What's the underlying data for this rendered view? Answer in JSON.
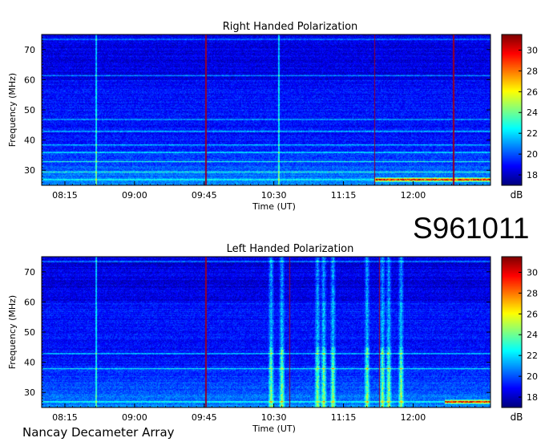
{
  "observation_id": "S961011",
  "instrument": "Nancay Decameter Array",
  "chart_data": [
    {
      "type": "heatmap",
      "title": "Right Handed Polarization",
      "xlabel": "Time (UT)",
      "ylabel": "Frequency (MHz)",
      "x_ticks": [
        "08:15",
        "09:00",
        "09:45",
        "10:30",
        "11:15",
        "12:00"
      ],
      "y_ticks": [
        30,
        40,
        50,
        60,
        70
      ],
      "xlim": [
        "08:00",
        "12:50"
      ],
      "ylim": [
        25,
        75
      ],
      "colorbar": {
        "label": "dB",
        "ticks": [
          18,
          20,
          22,
          24,
          26,
          28,
          30
        ],
        "range": [
          17,
          31.5
        ],
        "colormap": "jet"
      },
      "features": {
        "background_db": 19,
        "bright_vertical_lines_time": [
          "08:35",
          "10:33",
          "12:52"
        ],
        "dark_vertical_lines_time": [
          "09:46",
          "11:35",
          "12:26"
        ],
        "bright_horizontal_bands_mhz": [
          27,
          29.5,
          33,
          36,
          38.5,
          43,
          47,
          61.5,
          73.5
        ],
        "strong_emission": [
          {
            "time_start": "11:35",
            "time_end": "12:50",
            "freq_mhz": 27,
            "db": 30
          }
        ]
      }
    },
    {
      "type": "heatmap",
      "title": "Left Handed Polarization",
      "xlabel": "Time (UT)",
      "ylabel": "Frequency (MHz)",
      "x_ticks": [
        "08:15",
        "09:00",
        "09:45",
        "10:30",
        "11:15",
        "12:00"
      ],
      "y_ticks": [
        30,
        40,
        50,
        60,
        70
      ],
      "xlim": [
        "08:00",
        "12:50"
      ],
      "ylim": [
        25,
        75
      ],
      "colorbar": {
        "label": "dB",
        "ticks": [
          18,
          20,
          22,
          24,
          26,
          28,
          30
        ],
        "range": [
          17,
          31.5
        ],
        "colormap": "jet"
      },
      "features": {
        "background_db": 19,
        "bright_vertical_lines_time": [
          "08:35"
        ],
        "dark_vertical_lines_time": [
          "09:46",
          "10:40",
          "11:38"
        ],
        "bright_horizontal_bands_mhz": [
          27,
          38,
          43,
          73.5
        ],
        "burst_columns_time": [
          "10:28",
          "10:35",
          "10:58",
          "11:02",
          "11:08",
          "11:30",
          "11:40",
          "11:44",
          "11:52"
        ],
        "strong_emission": [
          {
            "time_start": "12:20",
            "time_end": "12:50",
            "freq_mhz": 27,
            "db": 30
          }
        ]
      }
    }
  ]
}
